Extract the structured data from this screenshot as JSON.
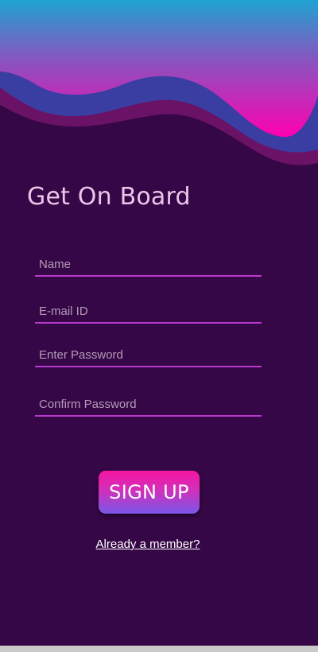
{
  "screen": {
    "title": "Get On Board"
  },
  "form": {
    "name_placeholder": "Name",
    "email_placeholder": "E-mail ID",
    "password_placeholder": "Enter Password",
    "confirm_placeholder": "Confirm Password",
    "submit_label": "SIGN UP"
  },
  "footer": {
    "login_link": "Already a member?"
  },
  "colors": {
    "background": "#360746",
    "accent": "#b93ad0",
    "button_top": "#f515a2",
    "button_bottom": "#7a57ea"
  }
}
